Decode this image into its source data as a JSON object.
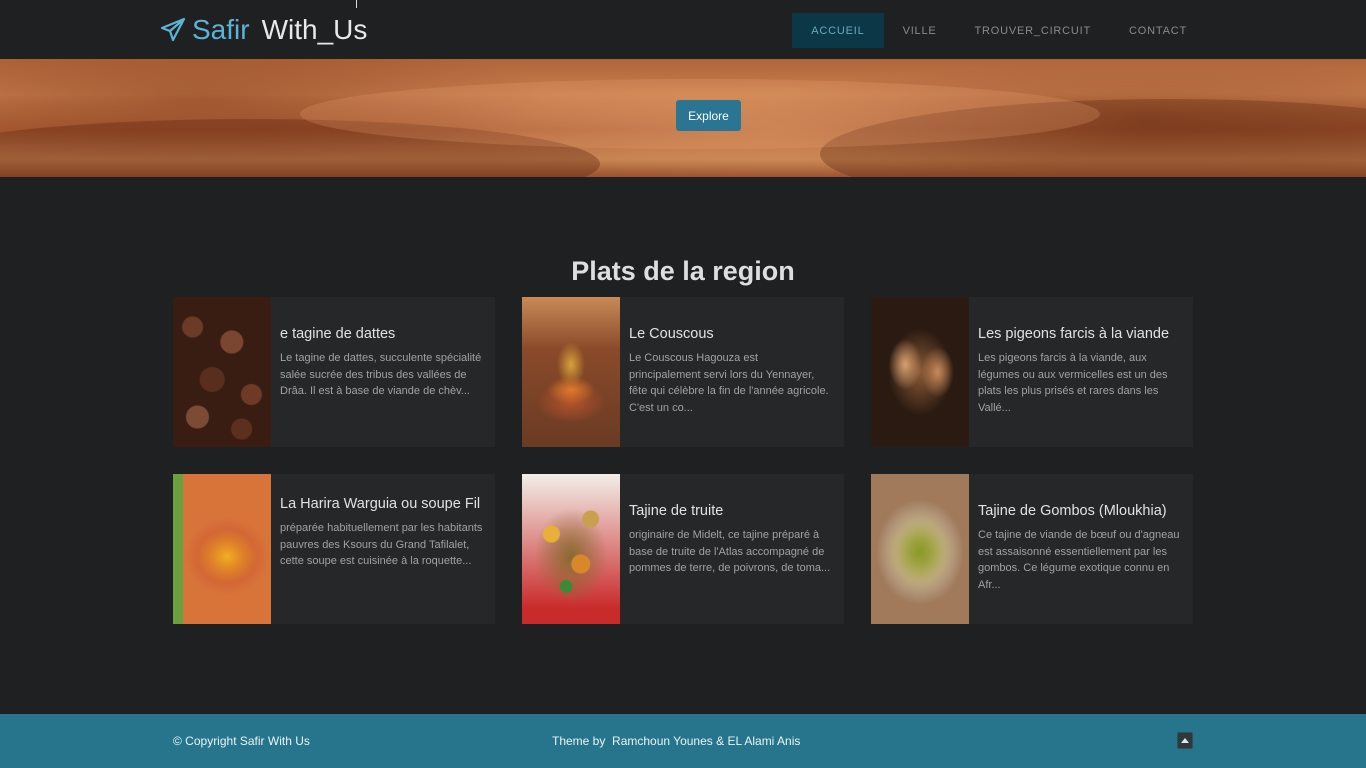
{
  "nav": {
    "brand_part1": "Safir",
    "brand_part2": "With_Us",
    "items": [
      {
        "label": "ACCUEIL",
        "active": true
      },
      {
        "label": "VILLE",
        "active": false
      },
      {
        "label": "TROUVER_CIRCUIT",
        "active": false
      },
      {
        "label": "CONTACT",
        "active": false
      }
    ],
    "icon": "paper-plane-icon"
  },
  "hero": {
    "button_label": "Explore"
  },
  "section": {
    "title": "Plats de la region"
  },
  "cards": [
    {
      "title": "e tagine de dattes",
      "text": "Le tagine de dattes, succulente spécialité salée sucrée des tribus des vallées de Drâa. Il est à base de viande de chèv..."
    },
    {
      "title": "Le Couscous",
      "text": "Le Couscous Hagouza est principalement servi lors du Yennayer, fête qui célèbre la fin de l'année agricole. C'est un co..."
    },
    {
      "title": "Les pigeons farcis à la viande",
      "text": "Les pigeons farcis à la viande, aux légumes ou aux vermicelles est un des plats les plus prisés et rares dans les Vallé..."
    },
    {
      "title": "La Harira Warguia ou soupe Fil",
      "text": "préparée habituellement par les habitants pauvres des Ksours du Grand Tafilalet, cette soupe est cuisinée à la roquette..."
    },
    {
      "title": "Tajine de truite",
      "text": "originaire de Midelt, ce tajine préparé à base de truite de l'Atlas accompagné de pommes de terre, de poivrons, de toma..."
    },
    {
      "title": "Tajine de Gombos (Mloukhia)",
      "text": "Ce tajine de viande de bœuf ou d'agneau est assaisonné essentiellement par les gombos. Ce légume exotique connu en Afr..."
    }
  ],
  "footer": {
    "copyright": "© Copyright Safir With Us",
    "theme": "Theme by  Ramchoun Younes & EL Alami Anis",
    "to_top_icon": "chevron-up-icon"
  },
  "colors": {
    "accent": "#27758d",
    "active_nav_bg": "#0c3746",
    "background": "#1f2021"
  }
}
